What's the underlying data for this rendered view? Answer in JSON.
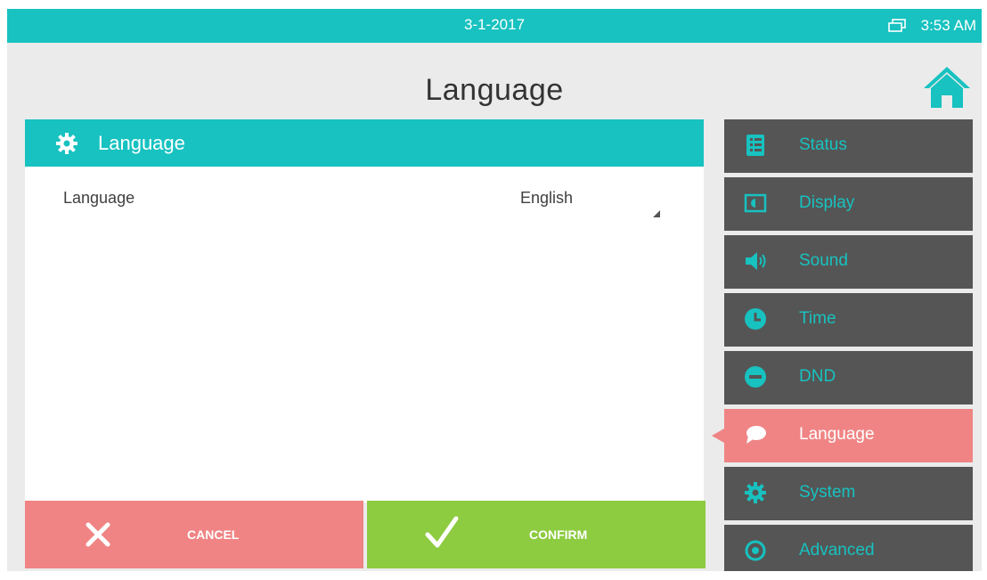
{
  "status_bar": {
    "date": "3-1-2017",
    "time": "3:53 AM",
    "network_icon": "network-icon"
  },
  "page_title": "Language",
  "home_icon": "home-icon",
  "panel": {
    "header_icon": "gear-icon",
    "header_title": "Language",
    "setting": {
      "label": "Language",
      "value": "English"
    }
  },
  "buttons": {
    "cancel_label": "CANCEL",
    "confirm_label": "CONFIRM"
  },
  "menu": {
    "items": [
      {
        "label": "Status",
        "icon": "status-icon"
      },
      {
        "label": "Display",
        "icon": "display-icon"
      },
      {
        "label": "Sound",
        "icon": "speaker-icon"
      },
      {
        "label": "Time",
        "icon": "clock-icon"
      },
      {
        "label": "DND",
        "icon": "dnd-icon"
      },
      {
        "label": "Language",
        "icon": "speech-bubble-icon"
      },
      {
        "label": "System",
        "icon": "gear-icon"
      },
      {
        "label": "Advanced",
        "icon": "target-icon"
      }
    ],
    "active_index": 5
  },
  "colors": {
    "teal": "#17c2c0",
    "coral": "#f08484",
    "green": "#8dcb41",
    "menu_dark": "#555555",
    "background": "#ebebeb"
  }
}
